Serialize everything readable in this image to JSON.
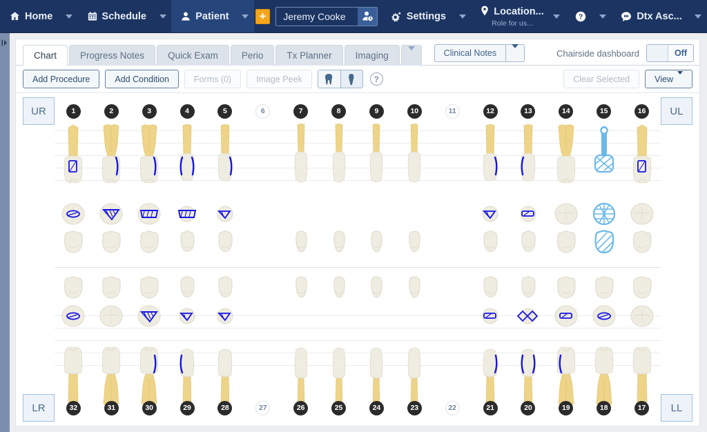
{
  "topnav": {
    "items": [
      {
        "label": "Home",
        "icon": "home-icon",
        "caret": true,
        "active": false
      },
      {
        "label": "Schedule",
        "icon": "calendar-icon",
        "caret": true,
        "active": false
      },
      {
        "label": "Patient",
        "icon": "person-icon",
        "caret": true,
        "active": true
      }
    ],
    "add_label": "+",
    "patient": {
      "value": "Jeremy Cooke",
      "placeholder": "Patient name",
      "icon": "person-clock-icon"
    },
    "right_items": [
      {
        "label": "Settings",
        "sub": "",
        "icon": "gear-icon",
        "caret": true
      },
      {
        "label": "Location...",
        "sub": "Role for us...",
        "icon": "pin-icon",
        "caret": true
      },
      {
        "label": "",
        "sub": "",
        "icon": "help-circle-icon",
        "caret": true
      },
      {
        "label": "Dtx Asc...",
        "sub": "",
        "icon": "chat-icon",
        "caret": true
      }
    ]
  },
  "tabs": [
    {
      "label": "Chart",
      "active": true
    },
    {
      "label": "Progress Notes",
      "active": false
    },
    {
      "label": "Quick Exam",
      "active": false
    },
    {
      "label": "Perio",
      "active": false
    },
    {
      "label": "Tx Planner",
      "active": false
    },
    {
      "label": "Imaging",
      "active": false
    }
  ],
  "tabs_more_icon": "chevron-down-icon",
  "clinical_notes": {
    "label": "Clinical Notes",
    "caret_icon": "chevron-down-icon"
  },
  "chairside": {
    "label": "Chairside dashboard",
    "state": "Off"
  },
  "toolbar": {
    "add_procedure": "Add Procedure",
    "add_condition": "Add Condition",
    "forms": "Forms (0)",
    "image_peek": "Image Peek",
    "molar_icon": "molar-tooth-icon",
    "incisor_icon": "incisor-tooth-icon",
    "help_icon": "help-circle-icon",
    "help_glyph": "?",
    "clear_selected": "Clear Selected",
    "view": "View"
  },
  "quadrants": {
    "upper_right": "UR",
    "upper_left": "UL",
    "lower_right": "LR",
    "lower_left": "LL"
  },
  "chart_data": {
    "type": "table",
    "title": "Odontogram - Universal Numbering System",
    "upper_arch": [
      {
        "num": "1",
        "missing": false
      },
      {
        "num": "2",
        "missing": false
      },
      {
        "num": "3",
        "missing": false
      },
      {
        "num": "4",
        "missing": false
      },
      {
        "num": "5",
        "missing": false
      },
      {
        "num": "6",
        "missing": true
      },
      {
        "num": "7",
        "missing": false
      },
      {
        "num": "8",
        "missing": false
      },
      {
        "num": "9",
        "missing": false
      },
      {
        "num": "10",
        "missing": false
      },
      {
        "num": "11",
        "missing": true
      },
      {
        "num": "12",
        "missing": false
      },
      {
        "num": "13",
        "missing": false
      },
      {
        "num": "14",
        "missing": false
      },
      {
        "num": "15",
        "missing": false
      },
      {
        "num": "16",
        "missing": false
      }
    ],
    "lower_arch": [
      {
        "num": "32",
        "missing": false
      },
      {
        "num": "31",
        "missing": false
      },
      {
        "num": "30",
        "missing": false
      },
      {
        "num": "29",
        "missing": false
      },
      {
        "num": "28",
        "missing": false
      },
      {
        "num": "27",
        "missing": true
      },
      {
        "num": "26",
        "missing": false
      },
      {
        "num": "25",
        "missing": false
      },
      {
        "num": "24",
        "missing": false
      },
      {
        "num": "23",
        "missing": false
      },
      {
        "num": "22",
        "missing": true
      },
      {
        "num": "21",
        "missing": false
      },
      {
        "num": "20",
        "missing": false
      },
      {
        "num": "19",
        "missing": false
      },
      {
        "num": "18",
        "missing": false
      },
      {
        "num": "17",
        "missing": false
      }
    ]
  },
  "colors": {
    "nav_bg": "#1c3461",
    "nav_active": "#26457a",
    "accent_orange": "#f3a51c",
    "restoration_blue": "#1414e6",
    "planned_blue": "#6cb9e8",
    "root_yellow": "#edd489",
    "crown_white": "#f0ece0",
    "badge_dark": "#2b2b2b"
  }
}
